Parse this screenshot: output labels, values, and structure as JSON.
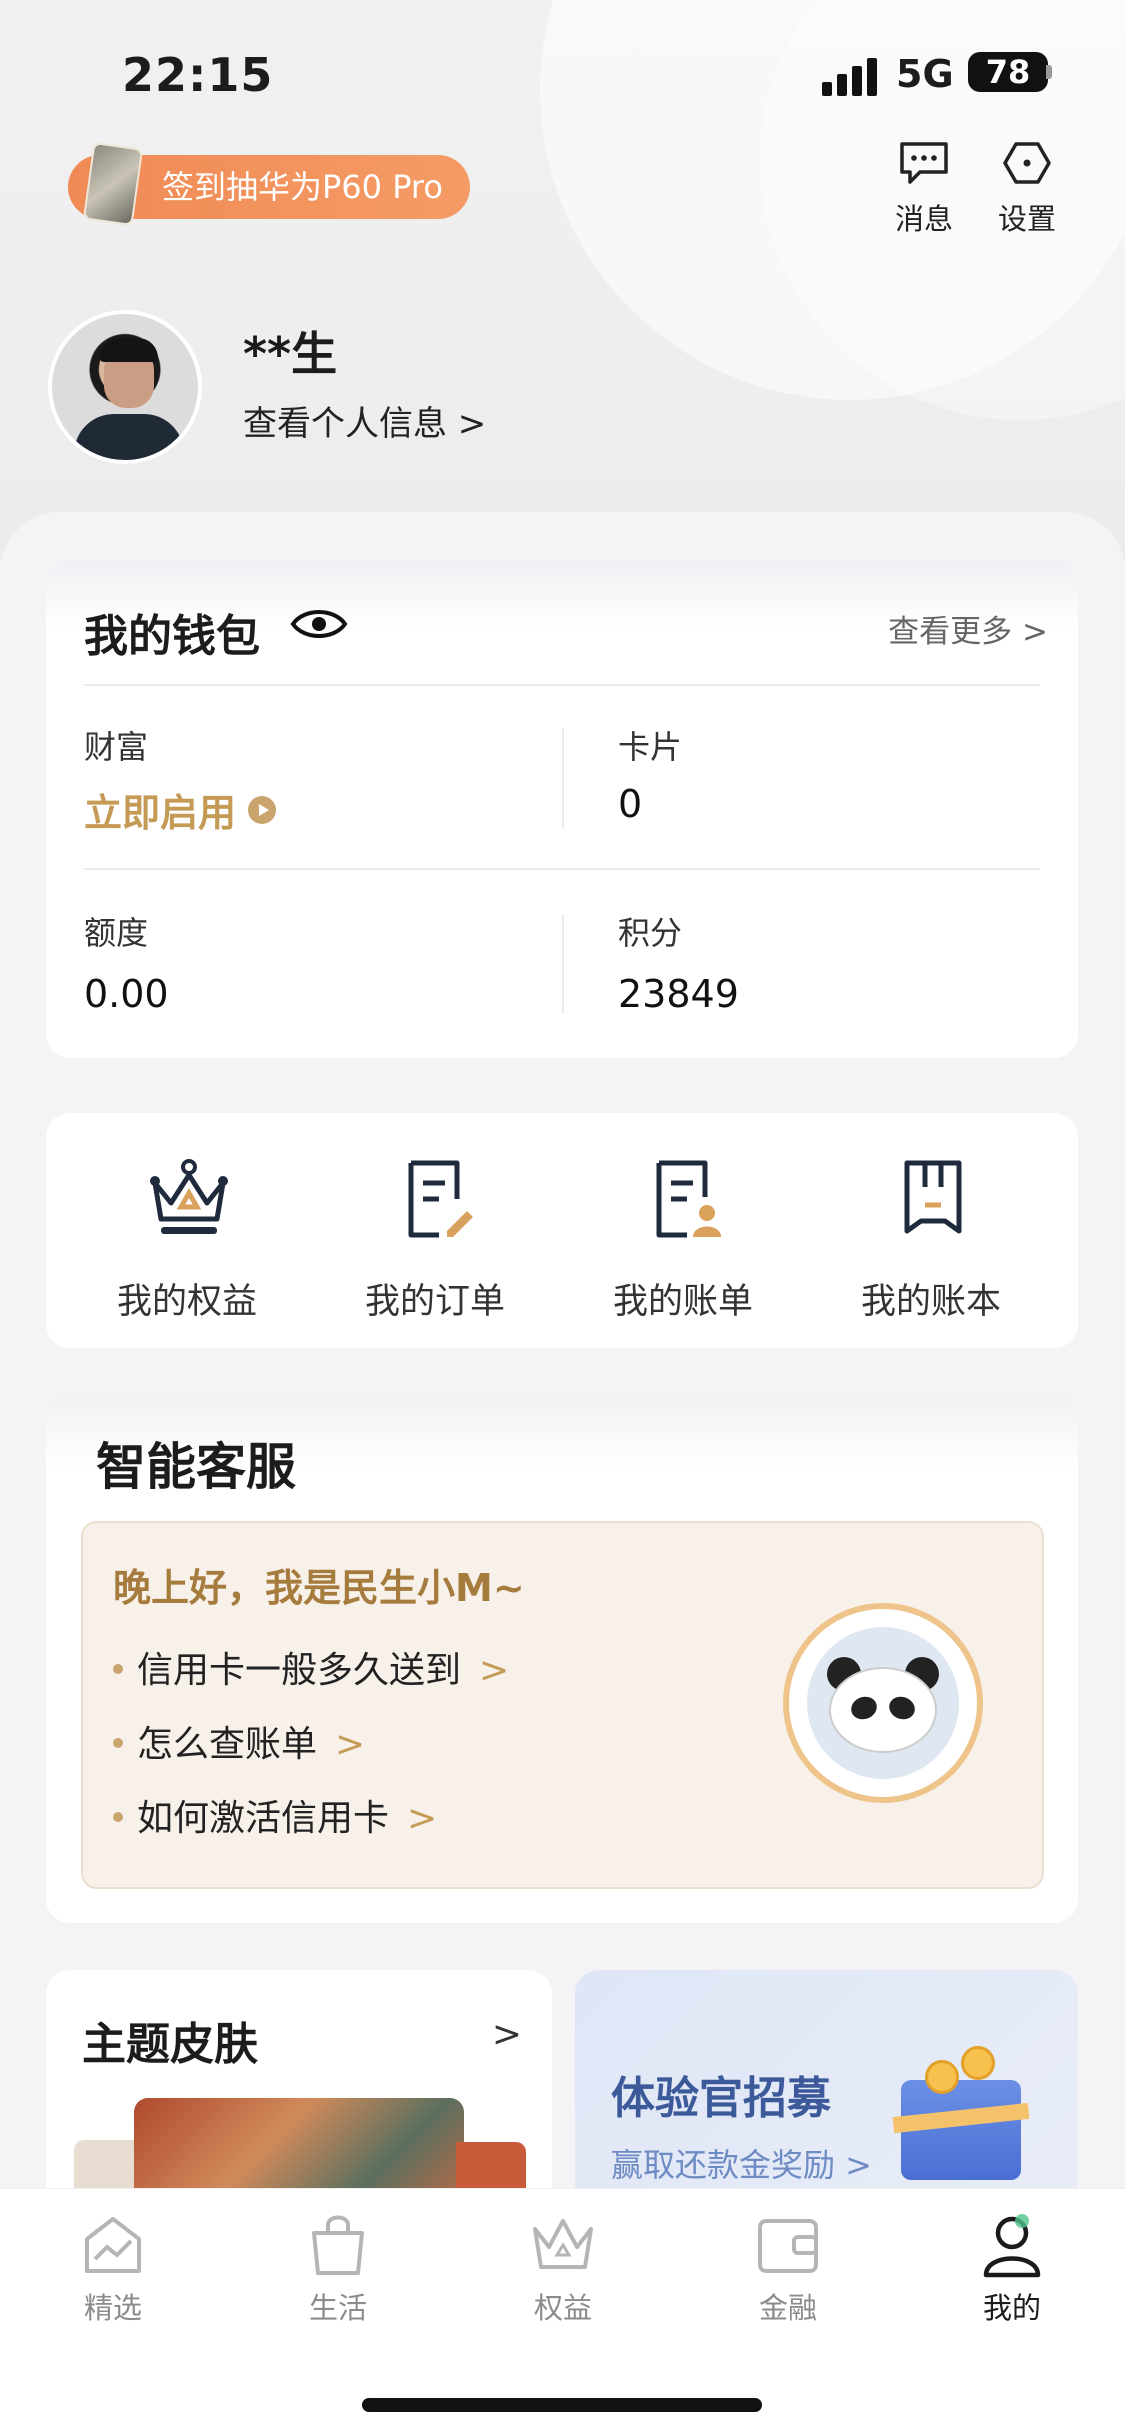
{
  "status_bar": {
    "time": "22:15",
    "network": "5G",
    "battery": "78"
  },
  "promo": {
    "label": "签到抽华为P60 Pro"
  },
  "top_actions": {
    "messages_label": "消息",
    "settings_label": "设置"
  },
  "profile": {
    "name": "**生",
    "link": "查看个人信息 >"
  },
  "wallet": {
    "title": "我的钱包",
    "more": "查看更多 >",
    "cells": [
      {
        "label": "财富",
        "value": "立即启用"
      },
      {
        "label": "卡片",
        "value": "0"
      },
      {
        "label": "额度",
        "value": "0.00"
      },
      {
        "label": "积分",
        "value": "23849"
      }
    ]
  },
  "quick_links": [
    {
      "label": "我的权益",
      "icon": "crown-icon"
    },
    {
      "label": "我的订单",
      "icon": "order-edit-icon"
    },
    {
      "label": "我的账单",
      "icon": "bill-user-icon"
    },
    {
      "label": "我的账本",
      "icon": "ledger-icon"
    }
  ],
  "customer_service": {
    "title": "智能客服",
    "greeting": "晚上好，我是民生小M~",
    "questions": [
      "信用卡一般多久送到",
      "怎么查账单",
      "如何激活信用卡"
    ],
    "arrow": ">"
  },
  "theme_skin": {
    "title": "主题皮肤",
    "arrow": ">"
  },
  "recruit": {
    "title": "体验官招募",
    "subtitle": "赢取还款金奖励 >"
  },
  "tab_bar": {
    "tabs": [
      {
        "label": "精选",
        "icon": "featured-icon"
      },
      {
        "label": "生活",
        "icon": "life-bag-icon"
      },
      {
        "label": "权益",
        "icon": "rights-crown-icon"
      },
      {
        "label": "金融",
        "icon": "wallet-icon"
      },
      {
        "label": "我的",
        "icon": "profile-icon",
        "active": true
      }
    ]
  },
  "colors": {
    "accent_gold": "#c49a55",
    "promo_orange": "#f08a55",
    "recruit_blue": "#3c5a9a"
  }
}
